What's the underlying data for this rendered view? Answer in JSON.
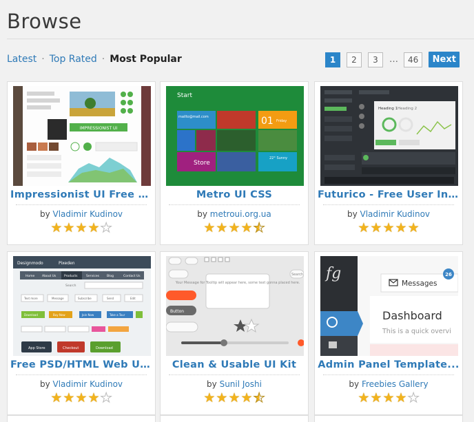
{
  "page": {
    "title": "Browse"
  },
  "filters": [
    {
      "label": "Latest",
      "active": false
    },
    {
      "label": "Top Rated",
      "active": false
    },
    {
      "label": "Most Popular",
      "active": true
    }
  ],
  "pagination": {
    "pages": [
      "1",
      "2",
      "3"
    ],
    "current": "1",
    "ellipsis": "…",
    "last": "46",
    "next_label": "Next"
  },
  "colors": {
    "accent": "#2b85c9",
    "link": "#2f7ab7",
    "star": "#f2b31d"
  },
  "items": [
    {
      "title": "Impressionist UI Free -...",
      "by": "by",
      "author": "Vladimir Kudinov",
      "rating": 4
    },
    {
      "title": "Metro UI CSS",
      "by": "by",
      "author": "metroui.org.ua",
      "rating": 4.5
    },
    {
      "title": "Futurico - Free User Int...",
      "by": "by",
      "author": "Vladimir Kudinov",
      "rating": 5
    },
    {
      "title": "Free PSD/HTML Web UI...",
      "by": "by",
      "author": "Vladimir Kudinov",
      "rating": 4
    },
    {
      "title": "Clean & Usable UI Kit",
      "by": "by",
      "author": "Sunil Joshi",
      "rating": 4.5
    },
    {
      "title": "Admin Panel Template...",
      "by": "by",
      "author": "Freebies Gallery",
      "rating": 4
    }
  ],
  "thumbs": {
    "impressionist": {
      "label": "IMPRESSIONIST UI",
      "menu": [
        "Popular",
        "Following",
        "Likes"
      ]
    },
    "metro": {
      "start": "Start",
      "email": "mailto@mail.com",
      "date": "01",
      "day": "Friday",
      "store": "Store",
      "weather": "22° Sunny"
    },
    "futurico": {
      "tab1": "Heading 1",
      "tab2": "Heading 2"
    },
    "psd": {
      "brand": "Designmodo",
      "brand2": "Pixeden",
      "nav": [
        "Home",
        "About Us",
        "Products",
        "Services",
        "Blog",
        "Contact Us"
      ],
      "search": "Search",
      "buttons": [
        "Text more",
        "Message",
        "Subscribe",
        "Send",
        "Edit"
      ],
      "colors": [
        "Download",
        "Buy Now",
        "Join Now",
        "Take a Tour"
      ],
      "store": "App Store",
      "checkout": "Checkout",
      "download": "Download"
    },
    "clean": {
      "tooltip": "Your Message for Tooltip will appear here, some text gonna placed here.",
      "button": "Button",
      "search": "Search"
    },
    "admin": {
      "messages": "Messages",
      "badge": "26",
      "dashboard": "Dashboard",
      "sub": "This is a quick overvi"
    }
  }
}
